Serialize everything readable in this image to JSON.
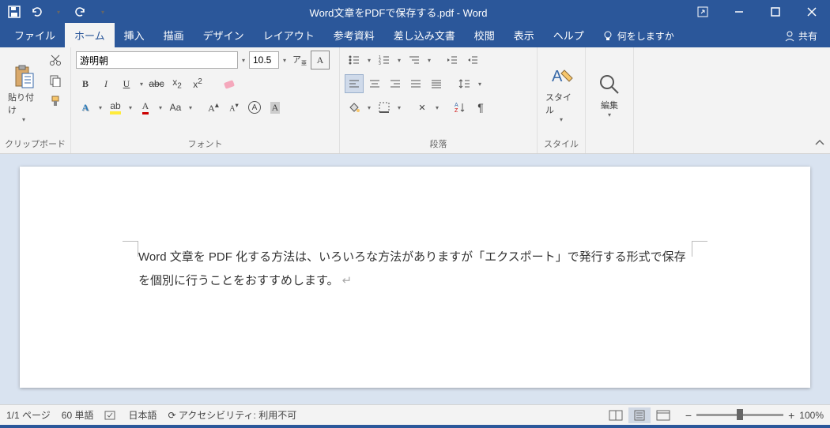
{
  "title": "Word文章をPDFで保存する.pdf  -  Word",
  "tabs": [
    "ファイル",
    "ホーム",
    "挿入",
    "描画",
    "デザイン",
    "レイアウト",
    "参考資料",
    "差し込み文書",
    "校閲",
    "表示",
    "ヘルプ"
  ],
  "active_tab": 1,
  "tell_me": "何をしますか",
  "share": "共有",
  "groups": {
    "clipboard": {
      "label": "クリップボード",
      "paste": "貼り付け"
    },
    "font": {
      "label": "フォント",
      "name": "游明朝",
      "size": "10.5"
    },
    "paragraph": {
      "label": "段落"
    },
    "styles": {
      "label": "スタイル",
      "btn": "スタイル"
    },
    "editing": {
      "label": "編集"
    }
  },
  "document": {
    "text": "Word 文章を PDF 化する方法は、いろいろな方法がありますが「エクスポート」で発行する形式で保存を個別に行うことをおすすめします。"
  },
  "status": {
    "page": "1/1 ページ",
    "words": "60 単語",
    "lang": "日本語",
    "a11y": "アクセシビリティ: 利用不可",
    "zoom": "100%"
  }
}
